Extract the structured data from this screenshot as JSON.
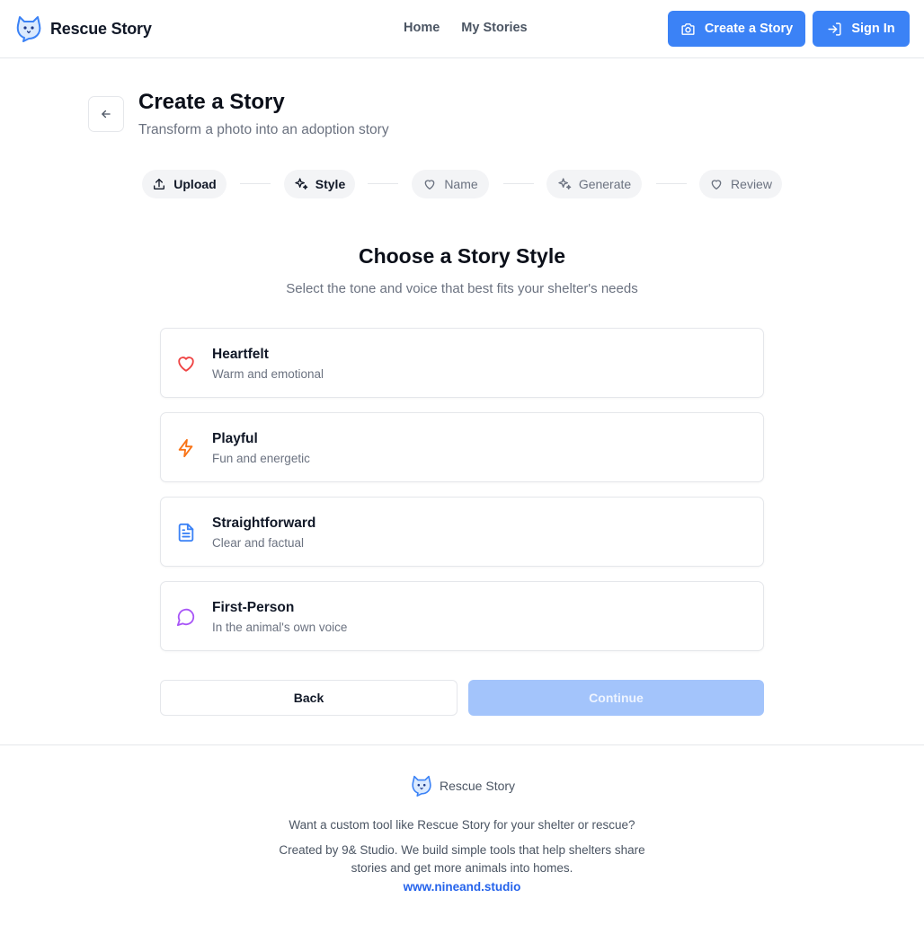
{
  "brand": {
    "name": "Rescue Story",
    "logo_icon": "cat-face-speech-bubble-icon"
  },
  "nav": {
    "home": "Home",
    "my_stories": "My Stories"
  },
  "header_buttons": {
    "create_story": "Create a Story",
    "create_story_icon": "camera-icon",
    "sign_in": "Sign In",
    "sign_in_icon": "sign-in-icon"
  },
  "page": {
    "title": "Create a Story",
    "subtitle": "Transform a photo into an adoption story",
    "back_icon": "arrow-left-icon"
  },
  "steps": [
    {
      "label": "Upload",
      "icon": "upload-icon",
      "state": "done"
    },
    {
      "label": "Style",
      "icon": "sparkles-icon",
      "state": "current"
    },
    {
      "label": "Name",
      "icon": "heart-icon",
      "state": "todo"
    },
    {
      "label": "Generate",
      "icon": "sparkles-icon",
      "state": "todo"
    },
    {
      "label": "Review",
      "icon": "heart-icon",
      "state": "todo"
    }
  ],
  "section": {
    "title": "Choose a Story Style",
    "subtitle": "Select the tone and voice that best fits your shelter's needs"
  },
  "styles": [
    {
      "name": "Heartfelt",
      "description": "Warm and emotional",
      "icon": "heart-icon",
      "color": "#ef4444"
    },
    {
      "name": "Playful",
      "description": "Fun and energetic",
      "icon": "lightning-bolt-icon",
      "color": "#f97316"
    },
    {
      "name": "Straightforward",
      "description": "Clear and factual",
      "icon": "document-icon",
      "color": "#3b82f6"
    },
    {
      "name": "First-Person",
      "description": "In the animal's own voice",
      "icon": "speech-bubble-icon",
      "color": "#a855f7"
    }
  ],
  "actions": {
    "back": "Back",
    "continue": "Continue",
    "continue_disabled": true
  },
  "footer": {
    "brand": "Rescue Story",
    "pitch": "Want a custom tool like Rescue Story for your shelter or rescue?",
    "credit_line1": "Created by 9& Studio. We build simple tools that help shelters share",
    "credit_line2": "stories and get more animals into homes.",
    "link": "www.nineand.studio"
  },
  "colors": {
    "accent": "#3b82f6",
    "accent_disabled": "#a3c4fb",
    "link": "#2563eb",
    "border": "#e5e7eb"
  }
}
